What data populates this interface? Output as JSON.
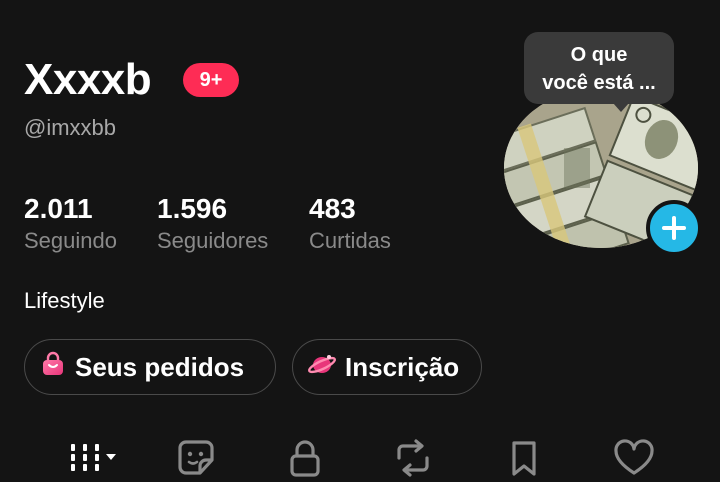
{
  "profile": {
    "name": "Xxxxb",
    "notification_badge": "9+",
    "handle": "@imxxbb",
    "bio": "Lifestyle"
  },
  "stats": [
    {
      "value": "2.011",
      "label": "Seguindo"
    },
    {
      "value": "1.596",
      "label": "Seguidores"
    },
    {
      "value": "483",
      "label": "Curtidas"
    }
  ],
  "buttons": {
    "orders_label": "Seus pedidos",
    "subscription_label": "Inscrição"
  },
  "status_bubble": {
    "line1": "O que",
    "line2": "você está ..."
  },
  "tabs": [
    {
      "icon": "grid-icon"
    },
    {
      "icon": "sticker-icon"
    },
    {
      "icon": "lock-icon"
    },
    {
      "icon": "repost-icon"
    },
    {
      "icon": "bookmark-icon"
    },
    {
      "icon": "heart-icon"
    }
  ],
  "colors": {
    "background": "#141414",
    "badge": "#fe2c55",
    "add_button": "#25b8e6",
    "secondary_text": "#8a8a8a"
  }
}
